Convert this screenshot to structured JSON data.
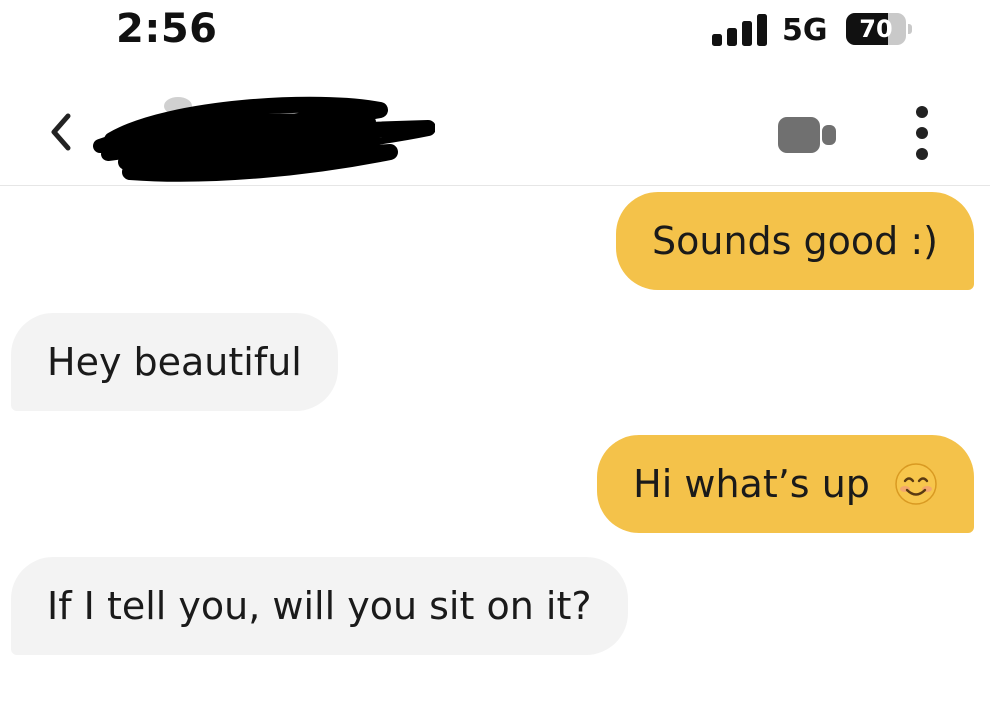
{
  "status_bar": {
    "time": "2:56",
    "network": "5G",
    "battery_level": "70",
    "battery_fraction": 0.7
  },
  "header": {
    "contact_name_redacted": true,
    "icons": {
      "back": "chevron-left-icon",
      "video_call": "video-camera-icon",
      "more": "more-vertical-icon"
    }
  },
  "colors": {
    "sent_bubble": "#f4c24a",
    "received_bubble": "#f3f3f3",
    "icon_gray": "#707070"
  },
  "messages": [
    {
      "direction": "sent",
      "text": "Sounds good :)"
    },
    {
      "direction": "received",
      "text": "Hey beautiful"
    },
    {
      "direction": "sent",
      "text": "Hi what’s up",
      "emoji": "smiling-face-icon"
    },
    {
      "direction": "received",
      "text": "If I tell you, will you sit on it?"
    }
  ]
}
